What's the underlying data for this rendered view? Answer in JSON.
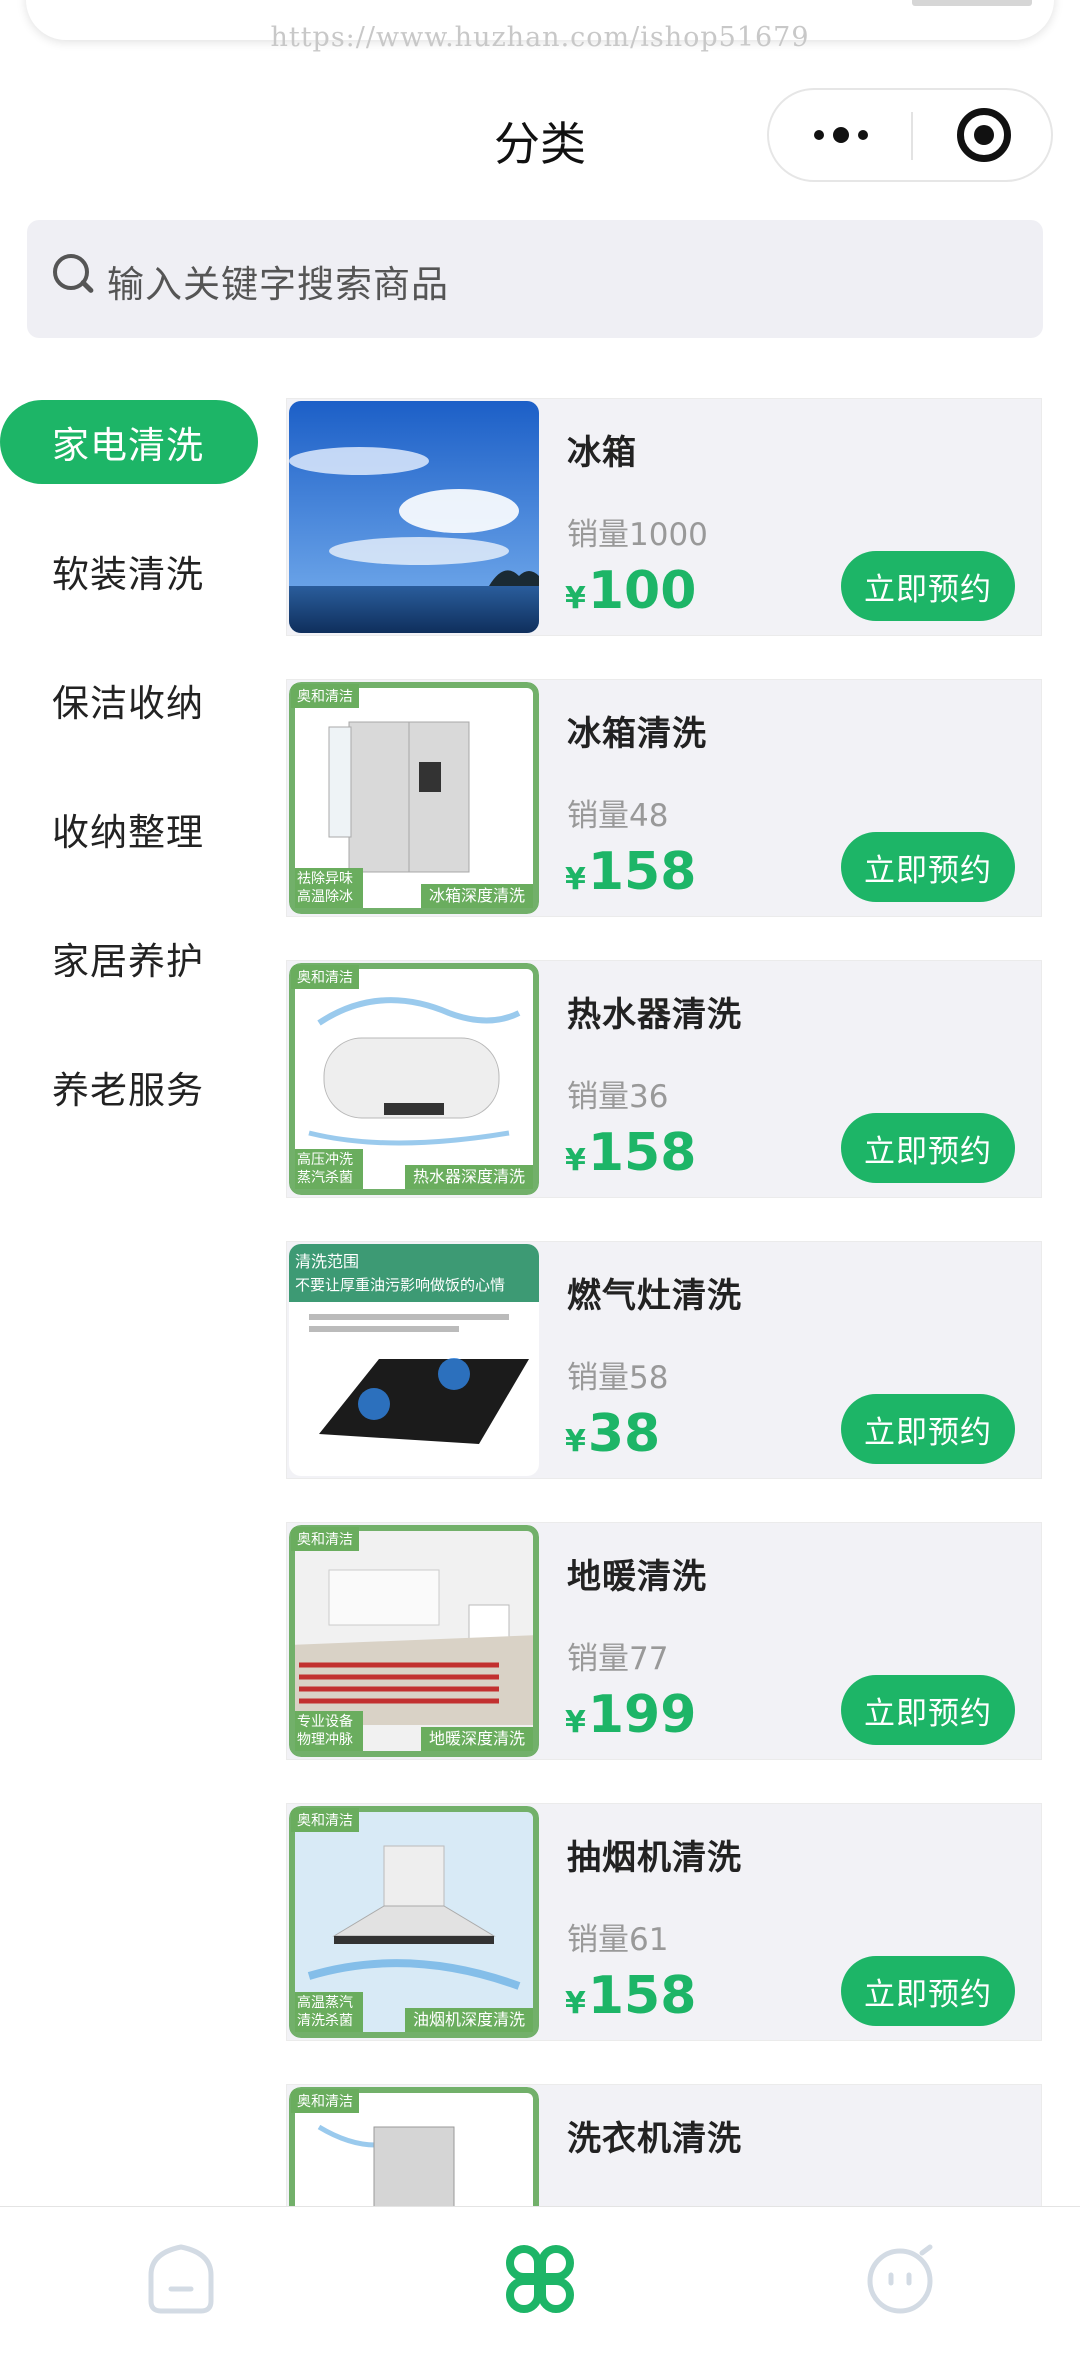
{
  "watermark": "https://www.huzhan.com/ishop51679",
  "nav": {
    "title": "分类"
  },
  "search": {
    "placeholder": "输入关键字搜索商品"
  },
  "sidebar": {
    "items": [
      {
        "label": "家电清洗",
        "active": true
      },
      {
        "label": "软装清洗",
        "active": false
      },
      {
        "label": "保洁收纳",
        "active": false
      },
      {
        "label": "收纳整理",
        "active": false
      },
      {
        "label": "家居养护",
        "active": false
      },
      {
        "label": "养老服务",
        "active": false
      }
    ]
  },
  "products": [
    {
      "name": "冰箱",
      "sales": "销量1000",
      "currency": "¥",
      "price": "100",
      "button": "立即预约"
    },
    {
      "name": "冰箱清洗",
      "sales": "销量48",
      "currency": "¥",
      "price": "158",
      "button": "立即预约",
      "thumb": {
        "brand": "奥和清洁",
        "left1": "祛除异味",
        "left2": "高温除冰",
        "banner": "冰箱深度清洗"
      }
    },
    {
      "name": "热水器清洗",
      "sales": "销量36",
      "currency": "¥",
      "price": "158",
      "button": "立即预约",
      "thumb": {
        "brand": "奥和清洁",
        "left1": "高压冲洗",
        "left2": "蒸汽杀菌",
        "banner": "热水器深度清洗"
      }
    },
    {
      "name": "燃气灶清洗",
      "sales": "销量58",
      "currency": "¥",
      "price": "38",
      "button": "立即预约",
      "thumb": {
        "top1": "清洗范围",
        "top2": "不要让厚重油污影响做饭的心情"
      }
    },
    {
      "name": "地暖清洗",
      "sales": "销量77",
      "currency": "¥",
      "price": "199",
      "button": "立即预约",
      "thumb": {
        "brand": "奥和清洁",
        "left1": "专业设备",
        "left2": "物理冲脉",
        "banner": "地暖深度清洗"
      }
    },
    {
      "name": "抽烟机清洗",
      "sales": "销量61",
      "currency": "¥",
      "price": "158",
      "button": "立即预约",
      "thumb": {
        "brand": "奥和清洁",
        "left1": "高温蒸汽",
        "left2": "清洗杀菌",
        "banner": "油烟机深度清洗"
      }
    },
    {
      "name": "洗衣机清洗",
      "sales": "",
      "currency": "",
      "price": "",
      "button": "",
      "thumb": {
        "brand": "奥和清洁"
      }
    }
  ],
  "tabbar": {
    "items": [
      {
        "icon": "home-icon",
        "active": false
      },
      {
        "icon": "category-icon",
        "active": true
      },
      {
        "icon": "profile-icon",
        "active": false
      }
    ]
  },
  "colors": {
    "accent": "#1db567",
    "search_bg": "#efeff4",
    "card_bg": "#f2f2f6"
  }
}
